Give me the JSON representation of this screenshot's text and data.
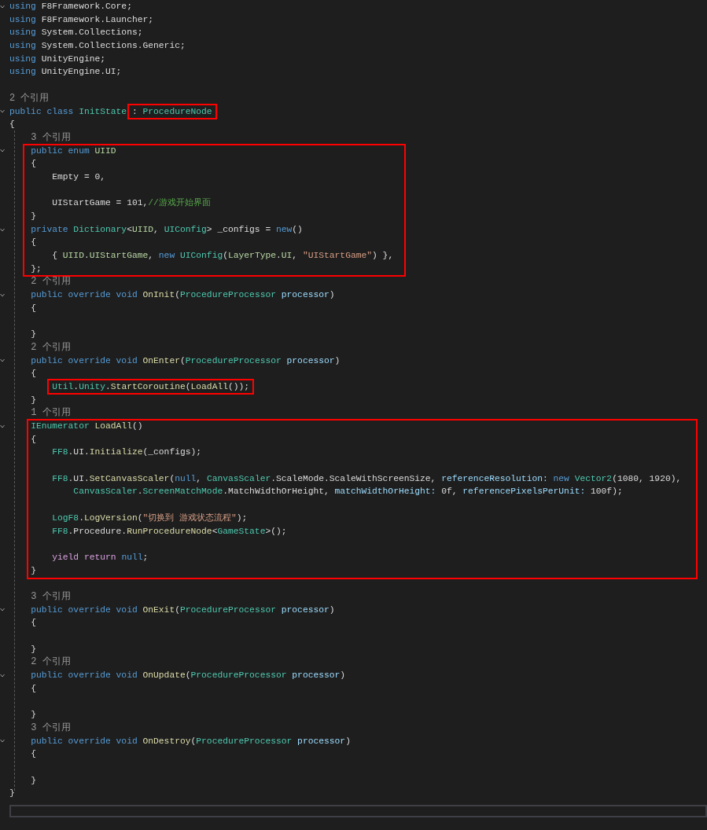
{
  "editor": {
    "segments": [
      {
        "kind": "lines",
        "lines": [
          {
            "kind": "code",
            "fold": true,
            "tokens": [
              {
                "text": "using",
                "kind": "kw"
              },
              {
                "text": " F8Framework.Core;",
                "kind": "plain"
              }
            ]
          },
          {
            "kind": "code",
            "fold": false,
            "tokens": [
              {
                "text": "using",
                "kind": "kw"
              },
              {
                "text": " F8Framework.Launcher;",
                "kind": "plain"
              }
            ]
          },
          {
            "kind": "code",
            "fold": false,
            "tokens": [
              {
                "text": "using",
                "kind": "kw"
              },
              {
                "text": " System.Collections;",
                "kind": "plain"
              }
            ]
          },
          {
            "kind": "code",
            "fold": false,
            "tokens": [
              {
                "text": "using",
                "kind": "kw"
              },
              {
                "text": " System.Collections.Generic;",
                "kind": "plain"
              }
            ]
          },
          {
            "kind": "code",
            "fold": false,
            "tokens": [
              {
                "text": "using",
                "kind": "kw"
              },
              {
                "text": " UnityEngine;",
                "kind": "plain"
              }
            ]
          },
          {
            "kind": "code",
            "fold": false,
            "tokens": [
              {
                "text": "using",
                "kind": "kw"
              },
              {
                "text": " UnityEngine.UI;",
                "kind": "plain"
              }
            ]
          },
          {
            "kind": "blank",
            "fold": false
          },
          {
            "kind": "lens",
            "fold": false,
            "text": "2 个引用"
          },
          {
            "kind": "code",
            "fold": true,
            "tokens": [
              {
                "text": "public class ",
                "kind": "kw"
              },
              {
                "text": "InitState ",
                "kind": "type"
              },
              {
                "kind": "box",
                "tokens": [
                  {
                    "text": ": ",
                    "kind": "plain"
                  },
                  {
                    "text": "ProcedureNode",
                    "kind": "type"
                  }
                ]
              }
            ]
          },
          {
            "kind": "code",
            "fold": false,
            "tokens": [
              {
                "text": "{",
                "kind": "plain"
              }
            ]
          },
          {
            "kind": "lens",
            "fold": false,
            "text": "    3 个引用"
          }
        ]
      },
      {
        "kind": "boxed-narrow",
        "lines": [
          {
            "kind": "code",
            "fold": true,
            "tokens": [
              {
                "text": "    public enum ",
                "kind": "kw"
              },
              {
                "text": "UIID",
                "kind": "enum"
              }
            ]
          },
          {
            "kind": "code",
            "fold": false,
            "tokens": [
              {
                "text": "    {",
                "kind": "plain"
              }
            ]
          },
          {
            "kind": "code",
            "fold": false,
            "tokens": [
              {
                "text": "        Empty = 0,",
                "kind": "plain"
              }
            ]
          },
          {
            "kind": "blank",
            "fold": false
          },
          {
            "kind": "code",
            "fold": false,
            "tokens": [
              {
                "text": "        UIStartGame = 101,",
                "kind": "plain"
              },
              {
                "text": "//游戏开始界面",
                "kind": "comment"
              }
            ]
          },
          {
            "kind": "code",
            "fold": false,
            "tokens": [
              {
                "text": "    }",
                "kind": "plain"
              }
            ]
          },
          {
            "kind": "code",
            "fold": true,
            "tokens": [
              {
                "text": "    private ",
                "kind": "kw"
              },
              {
                "text": "Dictionary",
                "kind": "type"
              },
              {
                "text": "<",
                "kind": "plain"
              },
              {
                "text": "UIID",
                "kind": "enum"
              },
              {
                "text": ", ",
                "kind": "plain"
              },
              {
                "text": "UIConfig",
                "kind": "type"
              },
              {
                "text": "> _configs = ",
                "kind": "plain"
              },
              {
                "text": "new",
                "kind": "kw"
              },
              {
                "text": "()",
                "kind": "plain"
              }
            ]
          },
          {
            "kind": "code",
            "fold": false,
            "tokens": [
              {
                "text": "    {",
                "kind": "plain"
              }
            ]
          },
          {
            "kind": "code",
            "fold": false,
            "tokens": [
              {
                "text": "        { ",
                "kind": "plain"
              },
              {
                "text": "UIID",
                "kind": "enum"
              },
              {
                "text": ".",
                "kind": "plain"
              },
              {
                "text": "UIStartGame",
                "kind": "enum"
              },
              {
                "text": ", ",
                "kind": "plain"
              },
              {
                "text": "new ",
                "kind": "kw"
              },
              {
                "text": "UIConfig",
                "kind": "type"
              },
              {
                "text": "(",
                "kind": "plain"
              },
              {
                "text": "LayerType",
                "kind": "enum"
              },
              {
                "text": ".",
                "kind": "plain"
              },
              {
                "text": "UI",
                "kind": "enum"
              },
              {
                "text": ", ",
                "kind": "plain"
              },
              {
                "text": "\"UIStartGame\"",
                "kind": "str"
              },
              {
                "text": ") },",
                "kind": "plain"
              }
            ]
          },
          {
            "kind": "code",
            "fold": false,
            "tokens": [
              {
                "text": "    };",
                "kind": "plain"
              }
            ]
          }
        ]
      },
      {
        "kind": "lines",
        "lines": [
          {
            "kind": "lens",
            "fold": false,
            "text": "    2 个引用"
          },
          {
            "kind": "code",
            "fold": true,
            "tokens": [
              {
                "text": "    public override void ",
                "kind": "kw"
              },
              {
                "text": "OnInit",
                "kind": "method"
              },
              {
                "text": "(",
                "kind": "plain"
              },
              {
                "text": "ProcedureProcessor",
                "kind": "type"
              },
              {
                "text": " processor",
                "kind": "param"
              },
              {
                "text": ")",
                "kind": "plain"
              }
            ]
          },
          {
            "kind": "code",
            "fold": false,
            "tokens": [
              {
                "text": "    {",
                "kind": "plain"
              }
            ]
          },
          {
            "kind": "blank",
            "fold": false
          },
          {
            "kind": "code",
            "fold": false,
            "tokens": [
              {
                "text": "    }",
                "kind": "plain"
              }
            ]
          },
          {
            "kind": "lens",
            "fold": false,
            "text": "    2 个引用"
          },
          {
            "kind": "code",
            "fold": true,
            "tokens": [
              {
                "text": "    public override void ",
                "kind": "kw"
              },
              {
                "text": "OnEnter",
                "kind": "method"
              },
              {
                "text": "(",
                "kind": "plain"
              },
              {
                "text": "ProcedureProcessor",
                "kind": "type"
              },
              {
                "text": " processor",
                "kind": "param"
              },
              {
                "text": ")",
                "kind": "plain"
              }
            ]
          },
          {
            "kind": "code",
            "fold": false,
            "tokens": [
              {
                "text": "    {",
                "kind": "plain"
              }
            ]
          },
          {
            "kind": "code",
            "fold": false,
            "tokens": [
              {
                "kind": "box",
                "tokens": [
                  {
                    "text": "        Util",
                    "kind": "type"
                  },
                  {
                    "text": ".",
                    "kind": "plain"
                  },
                  {
                    "text": "Unity",
                    "kind": "type"
                  },
                  {
                    "text": ".",
                    "kind": "plain"
                  },
                  {
                    "text": "StartCoroutine",
                    "kind": "method"
                  },
                  {
                    "text": "(",
                    "kind": "plain"
                  },
                  {
                    "text": "LoadAll",
                    "kind": "method"
                  },
                  {
                    "text": "());",
                    "kind": "plain"
                  }
                ]
              }
            ]
          },
          {
            "kind": "code",
            "fold": false,
            "tokens": [
              {
                "text": "    }",
                "kind": "plain"
              }
            ]
          },
          {
            "kind": "lens",
            "fold": false,
            "text": "    1 个引用"
          }
        ]
      },
      {
        "kind": "boxed-wide",
        "lines": [
          {
            "kind": "code",
            "fold": true,
            "tokens": [
              {
                "text": "    IEnumerator ",
                "kind": "type"
              },
              {
                "text": "LoadAll",
                "kind": "method"
              },
              {
                "text": "()",
                "kind": "plain"
              }
            ]
          },
          {
            "kind": "code",
            "fold": false,
            "tokens": [
              {
                "text": "    {",
                "kind": "plain"
              }
            ]
          },
          {
            "kind": "code",
            "fold": false,
            "tokens": [
              {
                "text": "        FF8",
                "kind": "type"
              },
              {
                "text": ".UI.",
                "kind": "plain"
              },
              {
                "text": "Initialize",
                "kind": "method"
              },
              {
                "text": "(_configs);",
                "kind": "plain"
              }
            ]
          },
          {
            "kind": "blank",
            "fold": false
          },
          {
            "kind": "code",
            "fold": false,
            "tokens": [
              {
                "text": "        FF8",
                "kind": "type"
              },
              {
                "text": ".UI.",
                "kind": "plain"
              },
              {
                "text": "SetCanvasScaler",
                "kind": "method"
              },
              {
                "text": "(",
                "kind": "plain"
              },
              {
                "text": "null",
                "kind": "kw"
              },
              {
                "text": ", ",
                "kind": "plain"
              },
              {
                "text": "CanvasScaler",
                "kind": "type"
              },
              {
                "text": ".ScaleMode.ScaleWithScreenSize, ",
                "kind": "plain"
              },
              {
                "text": "referenceResolution:",
                "kind": "param"
              },
              {
                "text": " new ",
                "kind": "kw"
              },
              {
                "text": "Vector2",
                "kind": "type"
              },
              {
                "text": "(1080, 1920),",
                "kind": "plain"
              }
            ]
          },
          {
            "kind": "code",
            "fold": false,
            "tokens": [
              {
                "text": "            CanvasScaler",
                "kind": "type"
              },
              {
                "text": ".",
                "kind": "plain"
              },
              {
                "text": "ScreenMatchMode",
                "kind": "type"
              },
              {
                "text": ".MatchWidthOrHeight, ",
                "kind": "plain"
              },
              {
                "text": "matchWidthOrHeight:",
                "kind": "param"
              },
              {
                "text": " 0f, ",
                "kind": "plain"
              },
              {
                "text": "referencePixelsPerUnit:",
                "kind": "param"
              },
              {
                "text": " 100f);",
                "kind": "plain"
              }
            ]
          },
          {
            "kind": "blank",
            "fold": false
          },
          {
            "kind": "code",
            "fold": false,
            "tokens": [
              {
                "text": "        LogF8",
                "kind": "type"
              },
              {
                "text": ".",
                "kind": "plain"
              },
              {
                "text": "LogVersion",
                "kind": "method"
              },
              {
                "text": "(",
                "kind": "plain"
              },
              {
                "text": "\"切换到 游戏状态流程\"",
                "kind": "str"
              },
              {
                "text": ");",
                "kind": "plain"
              }
            ]
          },
          {
            "kind": "code",
            "fold": false,
            "tokens": [
              {
                "text": "        FF8",
                "kind": "type"
              },
              {
                "text": ".Procedure.",
                "kind": "plain"
              },
              {
                "text": "RunProcedureNode",
                "kind": "method"
              },
              {
                "text": "<",
                "kind": "plain"
              },
              {
                "text": "GameState",
                "kind": "type"
              },
              {
                "text": ">();",
                "kind": "plain"
              }
            ]
          },
          {
            "kind": "blank",
            "fold": false
          },
          {
            "kind": "code",
            "fold": false,
            "tokens": [
              {
                "text": "        yield return ",
                "kind": "ctrl"
              },
              {
                "text": "null",
                "kind": "kw"
              },
              {
                "text": ";",
                "kind": "plain"
              }
            ]
          },
          {
            "kind": "code",
            "fold": false,
            "tokens": [
              {
                "text": "    }",
                "kind": "plain"
              }
            ]
          }
        ]
      },
      {
        "kind": "lines",
        "lines": [
          {
            "kind": "blank",
            "fold": false
          },
          {
            "kind": "lens",
            "fold": false,
            "text": "    3 个引用"
          },
          {
            "kind": "code",
            "fold": true,
            "tokens": [
              {
                "text": "    public override void ",
                "kind": "kw"
              },
              {
                "text": "OnExit",
                "kind": "method"
              },
              {
                "text": "(",
                "kind": "plain"
              },
              {
                "text": "ProcedureProcessor",
                "kind": "type"
              },
              {
                "text": " processor",
                "kind": "param"
              },
              {
                "text": ")",
                "kind": "plain"
              }
            ]
          },
          {
            "kind": "code",
            "fold": false,
            "tokens": [
              {
                "text": "    {",
                "kind": "plain"
              }
            ]
          },
          {
            "kind": "blank",
            "fold": false
          },
          {
            "kind": "code",
            "fold": false,
            "tokens": [
              {
                "text": "    }",
                "kind": "plain"
              }
            ]
          },
          {
            "kind": "lens",
            "fold": false,
            "text": "    2 个引用"
          },
          {
            "kind": "code",
            "fold": true,
            "tokens": [
              {
                "text": "    public override void ",
                "kind": "kw"
              },
              {
                "text": "OnUpdate",
                "kind": "method"
              },
              {
                "text": "(",
                "kind": "plain"
              },
              {
                "text": "ProcedureProcessor",
                "kind": "type"
              },
              {
                "text": " processor",
                "kind": "param"
              },
              {
                "text": ")",
                "kind": "plain"
              }
            ]
          },
          {
            "kind": "code",
            "fold": false,
            "tokens": [
              {
                "text": "    {",
                "kind": "plain"
              }
            ]
          },
          {
            "kind": "blank",
            "fold": false
          },
          {
            "kind": "code",
            "fold": false,
            "tokens": [
              {
                "text": "    }",
                "kind": "plain"
              }
            ]
          },
          {
            "kind": "lens",
            "fold": false,
            "text": "    3 个引用"
          },
          {
            "kind": "code",
            "fold": true,
            "tokens": [
              {
                "text": "    public override void ",
                "kind": "kw"
              },
              {
                "text": "OnDestroy",
                "kind": "method"
              },
              {
                "text": "(",
                "kind": "plain"
              },
              {
                "text": "ProcedureProcessor",
                "kind": "type"
              },
              {
                "text": " processor",
                "kind": "param"
              },
              {
                "text": ")",
                "kind": "plain"
              }
            ]
          },
          {
            "kind": "code",
            "fold": false,
            "tokens": [
              {
                "text": "    {",
                "kind": "plain"
              }
            ]
          },
          {
            "kind": "blank",
            "fold": false
          },
          {
            "kind": "code",
            "fold": false,
            "tokens": [
              {
                "text": "    }",
                "kind": "plain"
              }
            ]
          },
          {
            "kind": "code",
            "fold": false,
            "tokens": [
              {
                "text": "}",
                "kind": "plain"
              }
            ]
          }
        ]
      }
    ]
  }
}
